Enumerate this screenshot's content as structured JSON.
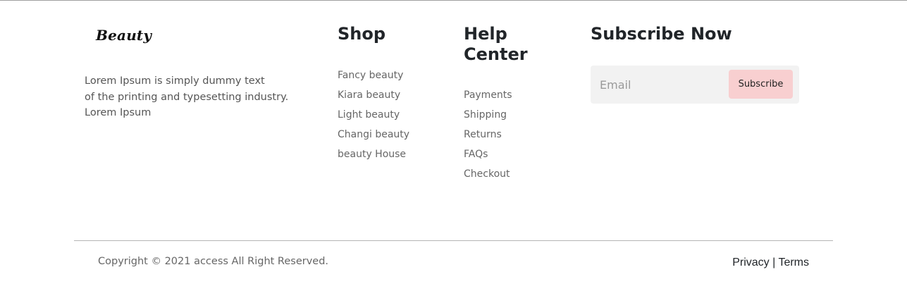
{
  "brand": {
    "logo_text": "Beauty",
    "description_lines": [
      "Lorem Ipsum is simply dummy text",
      "of the printing and typesetting industry.",
      "Lorem Ipsum"
    ]
  },
  "shop": {
    "heading": "Shop",
    "links": [
      "Fancy beauty",
      "Kiara beauty",
      "Light beauty",
      "Changi beauty",
      "beauty House"
    ]
  },
  "help_center": {
    "heading_lines": [
      "Help",
      "Center"
    ],
    "links": [
      "Payments",
      "Shipping",
      "Returns",
      "FAQs",
      "Checkout"
    ]
  },
  "subscribe": {
    "heading": "Subscribe Now",
    "email_placeholder": "Email",
    "email_value": "",
    "button_label": "Subscribe",
    "button_color": "#f8cfd0"
  },
  "bottom_bar": {
    "copyright": "Copyright © 2021 access All Right Reserved.",
    "privacy_label": "Privacy",
    "separator": "|",
    "terms_label": "Terms"
  }
}
